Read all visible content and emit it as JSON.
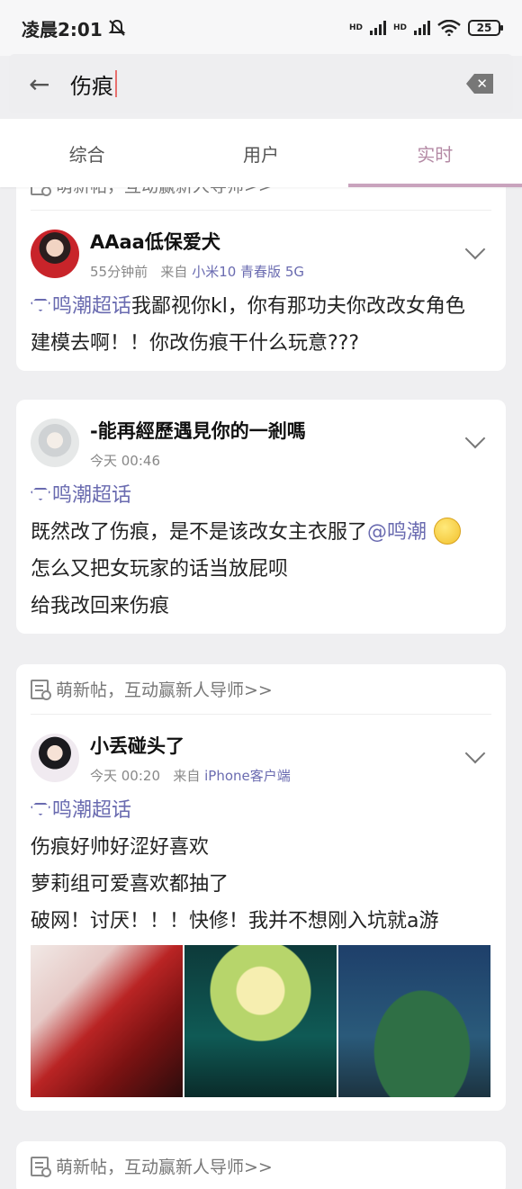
{
  "status": {
    "time": "凌晨2:01",
    "battery": "25",
    "net1": "HD",
    "net2": "HD"
  },
  "search": {
    "query": "伤痕"
  },
  "tabs": [
    {
      "label": "综合"
    },
    {
      "label": "用户"
    },
    {
      "label": "实时"
    }
  ],
  "hint_text": "萌新帖，互动赢新人导师>>",
  "posts": [
    {
      "user": "AAaa低保爱犬",
      "time": "55分钟前",
      "from": "来自",
      "device": "小米10 青春版 5G",
      "topic": "鸣潮超话",
      "lines": [
        "我鄙视你kl，你有那功夫你改改女角色",
        "建模去啊！！你改伤痕干什么玩意???"
      ]
    },
    {
      "user": "-能再經歷遇見你的一剎嗎",
      "time": "今天 00:46",
      "topic": "鸣潮超话",
      "line1": "既然改了伤痕，是不是该改女主衣服了",
      "mention": "@鸣潮",
      "line2": "怎么又把女玩家的话当放屁呗",
      "line3": "给我改回来伤痕"
    },
    {
      "user": "小丢碰头了",
      "time": "今天 00:20",
      "from": "来自",
      "device": "iPhone客户端",
      "topic": "鸣潮超话",
      "lines": [
        "伤痕好帅好涩好喜欢",
        "萝莉组可爱喜欢都抽了",
        "破网！讨厌！！！快修！我并不想刚入坑就a游"
      ]
    }
  ]
}
